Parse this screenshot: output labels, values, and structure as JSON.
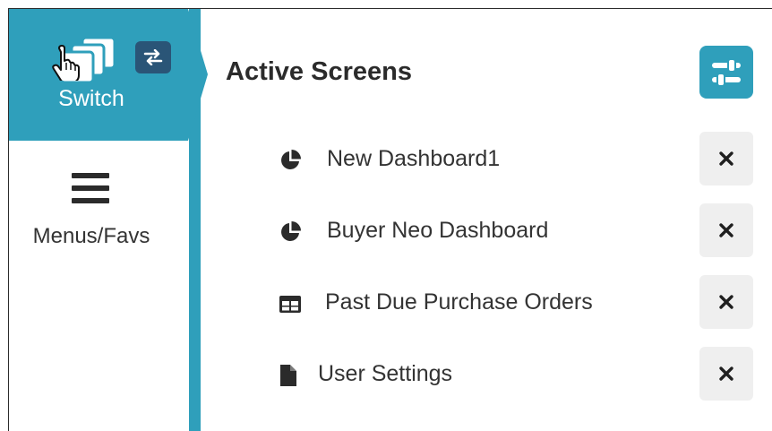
{
  "sidebar": {
    "switch": {
      "label": "Switch",
      "icon": "windows-stack-icon",
      "badge_icon": "swap-arrows-icon",
      "cursor_icon": "hand-pointer-icon"
    },
    "menus": {
      "label": "Menus/Favs",
      "icon": "hamburger-menu-icon"
    }
  },
  "panel": {
    "title": "Active Screens",
    "settings_icon": "sliders-icon"
  },
  "screens": [
    {
      "label": "New Dashboard1",
      "icon": "pie-chart-icon"
    },
    {
      "label": "Buyer Neo Dashboard",
      "icon": "pie-chart-icon"
    },
    {
      "label": "Past Due Purchase Orders",
      "icon": "table-icon"
    },
    {
      "label": "User Settings",
      "icon": "document-icon"
    }
  ],
  "colors": {
    "accent": "#2f9fbb",
    "badge": "#2a5577",
    "close_bg": "#efefef",
    "text": "#333333"
  }
}
